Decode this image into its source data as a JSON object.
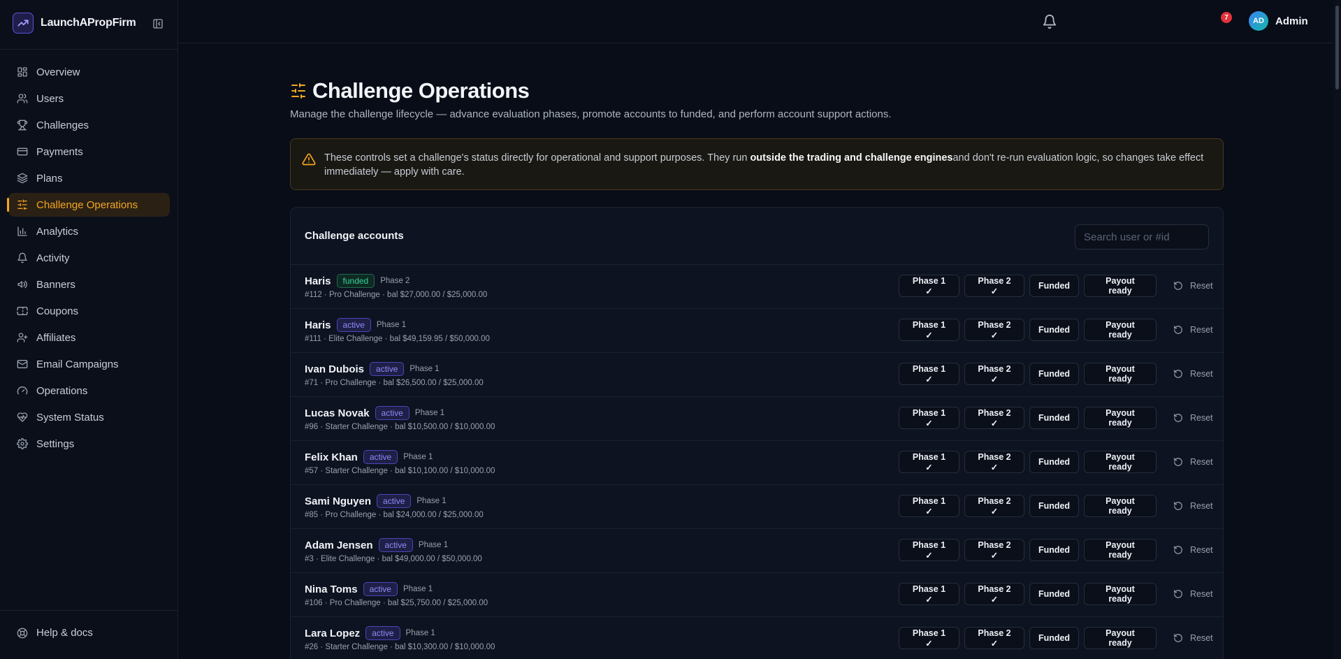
{
  "app": {
    "name": "LaunchAPropFirm",
    "logo_icon": "trend-chart-icon",
    "accent": "#f5a623",
    "background": "#080d17"
  },
  "sidebar": {
    "items": [
      {
        "label": "Overview",
        "icon": "grid-icon"
      },
      {
        "label": "Users",
        "icon": "users-icon"
      },
      {
        "label": "Challenges",
        "icon": "trophy-icon"
      },
      {
        "label": "Payments",
        "icon": "credit-card-icon"
      },
      {
        "label": "Plans",
        "icon": "layers-icon"
      },
      {
        "label": "Challenge Operations",
        "icon": "sliders-icon",
        "active": true
      },
      {
        "label": "Analytics",
        "icon": "bar-chart-icon"
      },
      {
        "label": "Activity",
        "icon": "bell-icon"
      },
      {
        "label": "Banners",
        "icon": "megaphone-icon"
      },
      {
        "label": "Coupons",
        "icon": "ticket-icon"
      },
      {
        "label": "Affiliates",
        "icon": "user-plus-icon"
      },
      {
        "label": "Email Campaigns",
        "icon": "mail-icon"
      },
      {
        "label": "Operations",
        "icon": "gauge-icon"
      },
      {
        "label": "System Status",
        "icon": "heart-pulse-icon"
      },
      {
        "label": "Settings",
        "icon": "gear-icon"
      }
    ],
    "help_label": "Help & docs"
  },
  "topbar": {
    "notification_count": "7",
    "avatar_initials": "AD",
    "user_name": "Admin"
  },
  "page": {
    "title": "Challenge Operations",
    "subtitle": "Manage the challenge lifecycle — advance evaluation phases, promote accounts to funded, and perform account support actions.",
    "alert": {
      "before": "These controls set a challenge's status directly for operational and support purposes. They run ",
      "strong": "outside the trading and challenge engines",
      "after": "and don't re-run evaluation logic, so changes take effect immediately — apply with care."
    }
  },
  "accounts": {
    "title": "Challenge accounts",
    "search_placeholder": "Search user or #id",
    "actions": {
      "phase1": "Phase 1 ✓",
      "phase2": "Phase 2 ✓",
      "funded": "Funded",
      "payout": "Payout ready",
      "reset": "Reset"
    },
    "rows": [
      {
        "name": "Haris",
        "status": "funded",
        "phase": "Phase 2",
        "detail": "#112 · Pro Challenge · bal $27,000.00 / $25,000.00"
      },
      {
        "name": "Haris",
        "status": "active",
        "phase": "Phase 1",
        "detail": "#111 · Elite Challenge · bal $49,159.95 / $50,000.00"
      },
      {
        "name": "Ivan Dubois",
        "status": "active",
        "phase": "Phase 1",
        "detail": "#71 · Pro Challenge · bal $26,500.00 / $25,000.00"
      },
      {
        "name": "Lucas Novak",
        "status": "active",
        "phase": "Phase 1",
        "detail": "#96 · Starter Challenge · bal $10,500.00 / $10,000.00"
      },
      {
        "name": "Felix Khan",
        "status": "active",
        "phase": "Phase 1",
        "detail": "#57 · Starter Challenge · bal $10,100.00 / $10,000.00"
      },
      {
        "name": "Sami Nguyen",
        "status": "active",
        "phase": "Phase 1",
        "detail": "#85 · Pro Challenge · bal $24,000.00 / $25,000.00"
      },
      {
        "name": "Adam Jensen",
        "status": "active",
        "phase": "Phase 1",
        "detail": "#3 · Elite Challenge · bal $49,000.00 / $50,000.00"
      },
      {
        "name": "Nina Toms",
        "status": "active",
        "phase": "Phase 1",
        "detail": "#106 · Pro Challenge · bal $25,750.00 / $25,000.00"
      },
      {
        "name": "Lara Lopez",
        "status": "active",
        "phase": "Phase 1",
        "detail": "#26 · Starter Challenge · bal $10,300.00 / $10,000.00"
      }
    ]
  }
}
